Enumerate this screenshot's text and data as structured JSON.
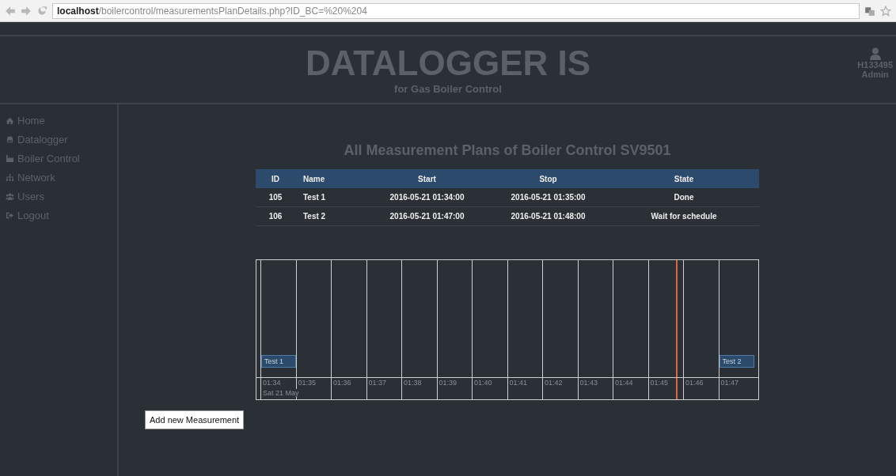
{
  "browser": {
    "url_host": "localhost",
    "url_path": "/boilercontrol/measurementsPlanDetails.php?ID_BC=%20%204"
  },
  "header": {
    "title": "DATALOGGER IS",
    "subtitle": "for Gas Boiler Control",
    "user": {
      "id": "H133495",
      "role": "Admin"
    }
  },
  "sidebar": {
    "items": [
      {
        "label": "Home"
      },
      {
        "label": "Datalogger"
      },
      {
        "label": "Boiler Control"
      },
      {
        "label": "Network"
      },
      {
        "label": "Users"
      },
      {
        "label": "Logout"
      }
    ]
  },
  "page_title": "All Measurement Plans of Boiler Control SV9501",
  "table": {
    "columns": [
      "ID",
      "Name",
      "Start",
      "Stop",
      "State"
    ],
    "rows": [
      [
        "105",
        "Test 1",
        "2016-05-21 01:34:00",
        "2016-05-21 01:35:00",
        "Done"
      ],
      [
        "106",
        "Test 2",
        "2016-05-21 01:47:00",
        "2016-05-21 01:48:00",
        "Wait for schedule"
      ]
    ]
  },
  "timeline": {
    "date_label": "Sat 21 May",
    "ticks": [
      {
        "label": "01:34",
        "items": [
          "Test 1"
        ],
        "current_time": false
      },
      {
        "label": "01:35",
        "current_time": false
      },
      {
        "label": "01:36",
        "current_time": false
      },
      {
        "label": "01:37",
        "current_time": false
      },
      {
        "label": "01:38",
        "current_time": false
      },
      {
        "label": "01:39",
        "current_time": false
      },
      {
        "label": "01:40",
        "current_time": false
      },
      {
        "label": "01:41",
        "current_time": false
      },
      {
        "label": "01:42",
        "current_time": false
      },
      {
        "label": "01:43",
        "current_time": false
      },
      {
        "label": "01:44",
        "current_time": false
      },
      {
        "label": "01:45",
        "current_time": true
      },
      {
        "label": "01:46",
        "current_time": false
      },
      {
        "label": "01:47",
        "items": [
          "Test 2"
        ],
        "current_time": false
      }
    ]
  },
  "add_button": "Add new Measurement"
}
